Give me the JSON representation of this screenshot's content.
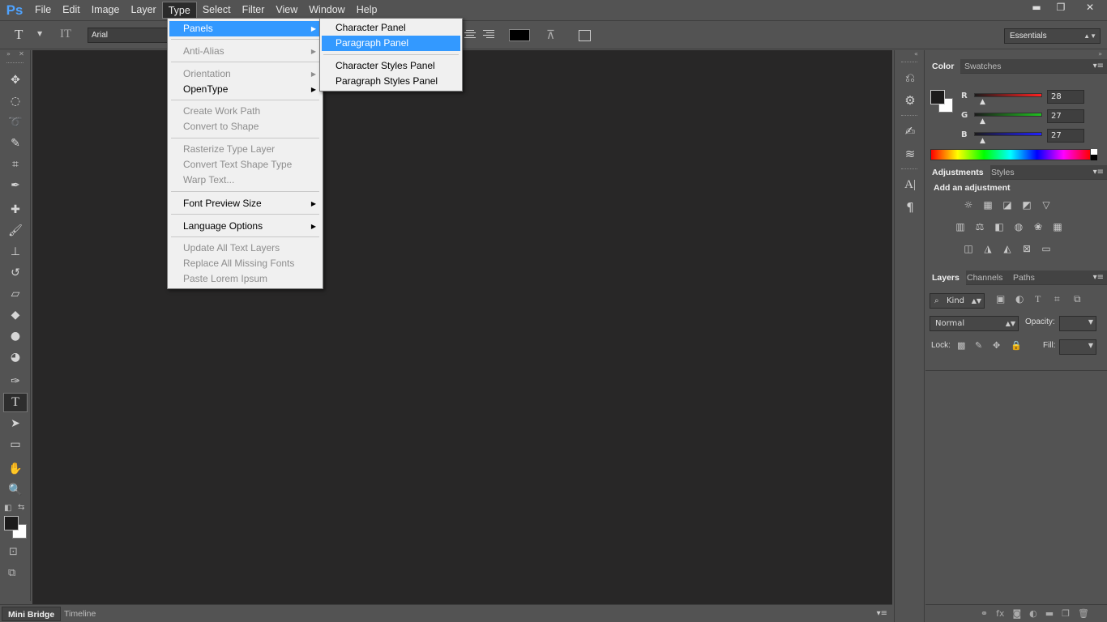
{
  "app": {
    "logo": "Ps"
  },
  "menubar": {
    "items": [
      "File",
      "Edit",
      "Image",
      "Layer",
      "Type",
      "Select",
      "Filter",
      "View",
      "Window",
      "Help"
    ],
    "active": "Type"
  },
  "window_controls": {
    "minimize": "▬",
    "restore": "❐",
    "close": "✕"
  },
  "options_bar": {
    "tool_glyph": "T",
    "orient_glyph": "IT",
    "font_family": "Arial",
    "text_color": "#000000",
    "workspace": "Essentials"
  },
  "type_menu": {
    "items": [
      {
        "label": "Panels",
        "submenu": true,
        "enabled": true,
        "highlighted": true
      },
      {
        "label": "Anti-Alias",
        "submenu": true,
        "enabled": false
      },
      {
        "label": "Orientation",
        "submenu": true,
        "enabled": false
      },
      {
        "label": "OpenType",
        "submenu": true,
        "enabled": true
      },
      {
        "label": "Create Work Path",
        "enabled": false
      },
      {
        "label": "Convert to Shape",
        "enabled": false
      },
      {
        "label": "Rasterize Type Layer",
        "enabled": false
      },
      {
        "label": "Convert Text Shape Type",
        "enabled": false
      },
      {
        "label": "Warp Text...",
        "enabled": false
      },
      {
        "label": "Font Preview Size",
        "submenu": true,
        "enabled": true
      },
      {
        "label": "Language Options",
        "submenu": true,
        "enabled": true
      },
      {
        "label": "Update All Text Layers",
        "enabled": false
      },
      {
        "label": "Replace All Missing Fonts",
        "enabled": false
      },
      {
        "label": "Paste Lorem Ipsum",
        "enabled": false
      }
    ]
  },
  "panels_submenu": {
    "items": [
      {
        "label": "Character Panel",
        "highlighted": false
      },
      {
        "label": "Paragraph Panel",
        "highlighted": true
      },
      {
        "label": "Character Styles Panel",
        "highlighted": false
      },
      {
        "label": "Paragraph Styles Panel",
        "highlighted": false
      }
    ]
  },
  "bottom_tabs": [
    "Mini Bridge",
    "Timeline"
  ],
  "color_panel": {
    "tabs": [
      "Color",
      "Swatches"
    ],
    "foreground": "#1c1b1b",
    "background": "#ffffff",
    "channels": [
      {
        "label": "R",
        "value": "28",
        "color": "#ff2020"
      },
      {
        "label": "G",
        "value": "27",
        "color": "#20c020"
      },
      {
        "label": "B",
        "value": "27",
        "color": "#2020ff"
      }
    ]
  },
  "adjustments_panel": {
    "tabs": [
      "Adjustments",
      "Styles"
    ],
    "title": "Add an adjustment"
  },
  "layers_panel": {
    "tabs": [
      "Layers",
      "Channels",
      "Paths"
    ],
    "kind_label": "Kind",
    "blend_mode": "Normal",
    "opacity_label": "Opacity:",
    "lock_label": "Lock:",
    "fill_label": "Fill:"
  }
}
